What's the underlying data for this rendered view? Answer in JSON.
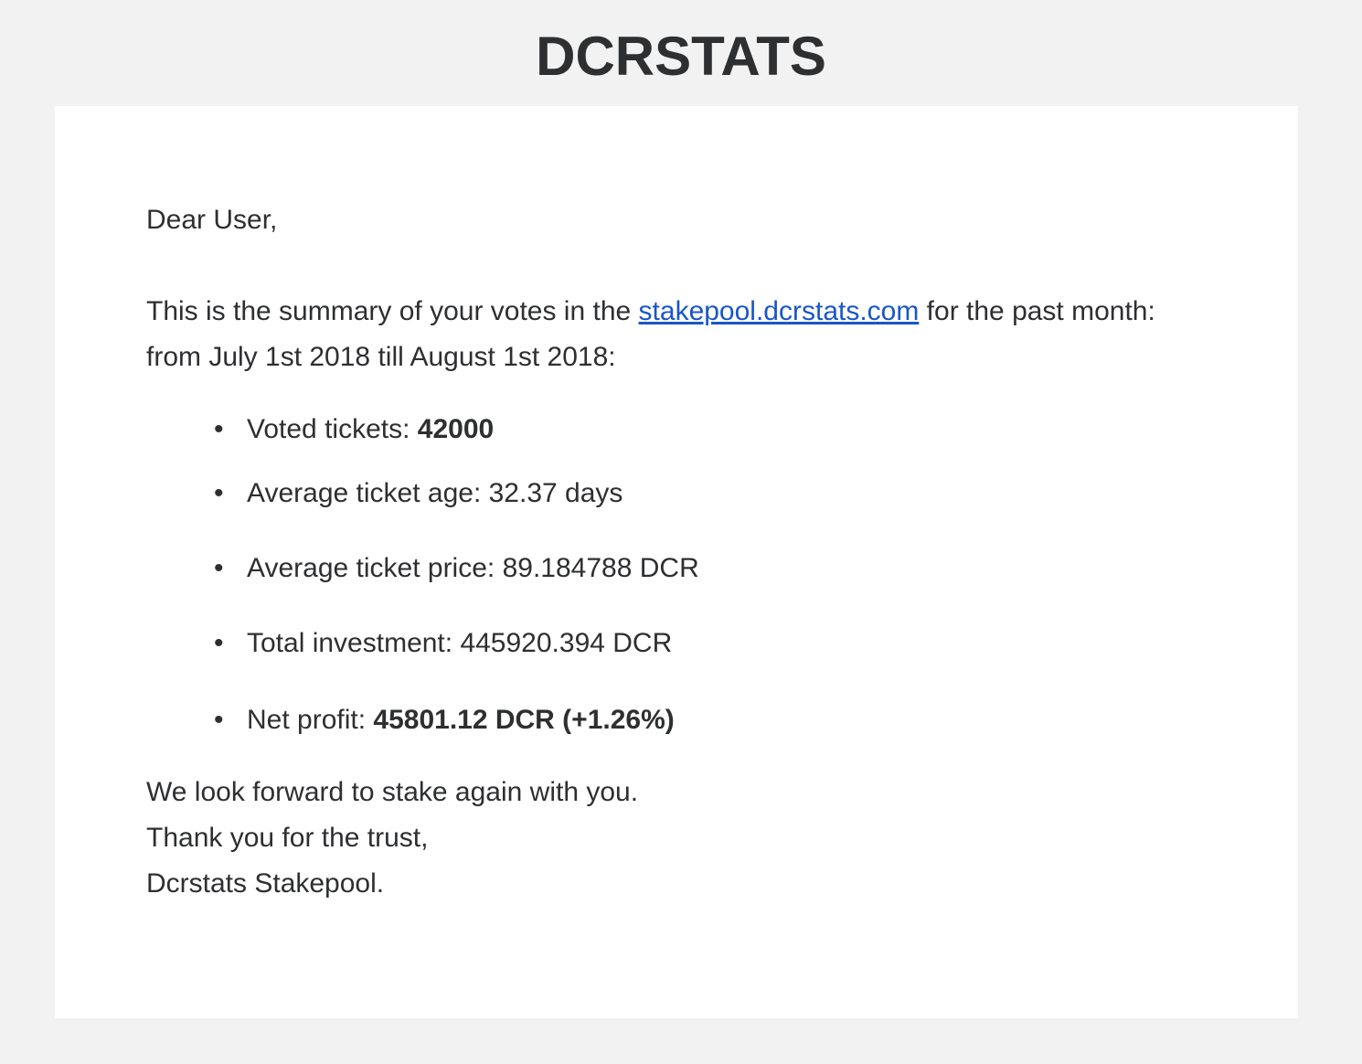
{
  "header": {
    "brand": "DCRSTATS"
  },
  "email": {
    "greeting": "Dear User,",
    "intro_prefix": "This is the summary of your votes in the ",
    "intro_link": "stakepool.dcrstats.com",
    "intro_suffix": " for the past month: from July 1st 2018 till August 1st 2018:",
    "stats": [
      {
        "label": "Voted tickets: ",
        "value": "42000",
        "bold": true
      },
      {
        "label": "Average ticket age: ",
        "value": "32.37 days",
        "bold": false
      },
      {
        "label": "Average ticket price: ",
        "value": "89.184788 DCR",
        "bold": false
      },
      {
        "label": "Total investment: ",
        "value": "445920.394 DCR",
        "bold": false
      },
      {
        "label": "Net profit: ",
        "value": "45801.12 DCR (+1.26%)",
        "bold": true
      }
    ],
    "closing_lines": [
      "We look forward to stake again with you.",
      "Thank you for the trust,",
      "Dcrstats Stakepool."
    ],
    "bullet": "•"
  },
  "colors": {
    "background": "#f2f2f2",
    "card": "#ffffff",
    "text": "#2e2f31",
    "link": "#1a56c8"
  }
}
